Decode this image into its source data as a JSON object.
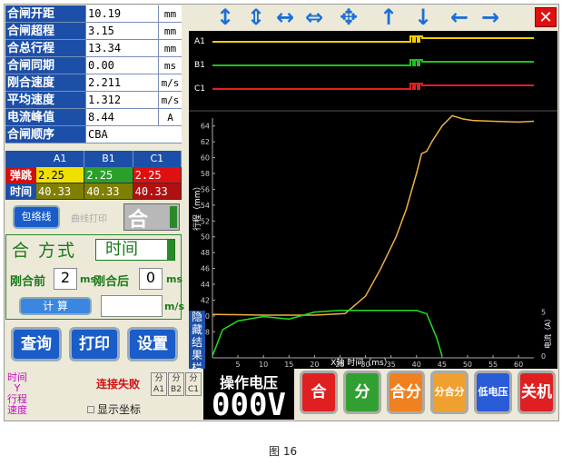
{
  "params": [
    {
      "label": "合闸开距",
      "value": "10.19",
      "unit": "mm"
    },
    {
      "label": "合闸超程",
      "value": "3.15",
      "unit": "mm"
    },
    {
      "label": "合总行程",
      "value": "13.34",
      "unit": "mm"
    },
    {
      "label": "合闸同期",
      "value": "0.00",
      "unit": "ms"
    },
    {
      "label": "刚合速度",
      "value": "2.211",
      "unit": "m/s"
    },
    {
      "label": "平均速度",
      "value": "1.312",
      "unit": "m/s"
    },
    {
      "label": "电流峰值",
      "value": "8.44",
      "unit": "A"
    },
    {
      "label": "合闸顺序",
      "value": "CBA",
      "unit": ""
    }
  ],
  "bounce": {
    "headers": [
      "A1",
      "B1",
      "C1"
    ],
    "bounce_label": "弹跳",
    "bounce_values": [
      "2.25",
      "2.25",
      "2.25"
    ],
    "time_label": "时间",
    "time_values": [
      "40.33",
      "40.33",
      "40.33"
    ]
  },
  "envelope_button": "包络线",
  "envelope_text": "曲线打印",
  "he_value": "合",
  "mode": {
    "label": "合 方式",
    "select": "时间",
    "before_label": "刚合前",
    "before_value": "2",
    "before_unit": "ms",
    "after_label": "刚合后",
    "after_value": "0",
    "after_unit": "ms",
    "calc_button": "计 算",
    "speed_unit": "m/s"
  },
  "buttons": {
    "query": "查询",
    "print": "打印",
    "settings": "设置"
  },
  "bottom": {
    "axis_label": "时间\nY\n行程\n速度",
    "fail_text": "连接失败",
    "show_coord": "显示坐标",
    "fen_labels": [
      "分\nA1",
      "分\nB2",
      "分\nC1"
    ],
    "voltage_label": "操作电压",
    "voltage_value": "000V"
  },
  "control_buttons": [
    {
      "label": "合",
      "color": "#e02020"
    },
    {
      "label": "分",
      "color": "#30a030"
    },
    {
      "label": "合分",
      "color": "#f08020"
    },
    {
      "label": "分合分",
      "color": "#f0a030"
    },
    {
      "label": "低电压",
      "color": "#2a5cd8"
    },
    {
      "label": "关机",
      "color": "#e02020"
    }
  ],
  "toolbar_icons": [
    "expand-vertical-icon",
    "compress-vertical-icon",
    "expand-horizontal-icon",
    "compress-horizontal-icon",
    "move-all-icon",
    "up-arrow-icon",
    "down-arrow-icon",
    "left-arrow-icon",
    "right-arrow-icon"
  ],
  "side_label": "隐藏结果栏",
  "caption": "图 16",
  "chart_data": {
    "type": "line",
    "channels": [
      "A1",
      "B1",
      "C1"
    ],
    "channel_colors": [
      "#f0d000",
      "#20c020",
      "#e02020"
    ],
    "xlabel": "X轴 时间（ms）",
    "ylabel_left": "行程（mm）",
    "ylabel_right": "电流（A）",
    "xlim": [
      0,
      63
    ],
    "x_ticks": [
      5,
      10,
      15,
      20,
      25,
      30,
      35,
      40,
      45,
      50,
      55,
      60
    ],
    "ylim": [
      37,
      65
    ],
    "y_ticks": [
      38,
      40,
      42,
      44,
      46,
      48,
      50,
      52,
      54,
      56,
      58,
      60,
      62,
      64
    ],
    "y2_ticks": [
      0,
      5
    ],
    "travel_curve": {
      "x": [
        0,
        10,
        20,
        26,
        30,
        33,
        36,
        38,
        40,
        41,
        42,
        43,
        45,
        47,
        49,
        51,
        55,
        60,
        63
      ],
      "y": [
        40.2,
        40.1,
        40.1,
        40.3,
        42.5,
        46,
        50,
        53.5,
        58,
        60.5,
        60.8,
        62,
        64,
        65.3,
        64.9,
        64.7,
        64.6,
        64.5,
        64.6
      ]
    },
    "current_curve": {
      "x": [
        0,
        2,
        5,
        10,
        15,
        20,
        25,
        30,
        35,
        40,
        42,
        44,
        45
      ],
      "y": [
        0,
        3,
        4,
        4.5,
        4.2,
        5,
        5.2,
        5.2,
        5.2,
        5.2,
        4.8,
        2,
        0
      ]
    }
  }
}
